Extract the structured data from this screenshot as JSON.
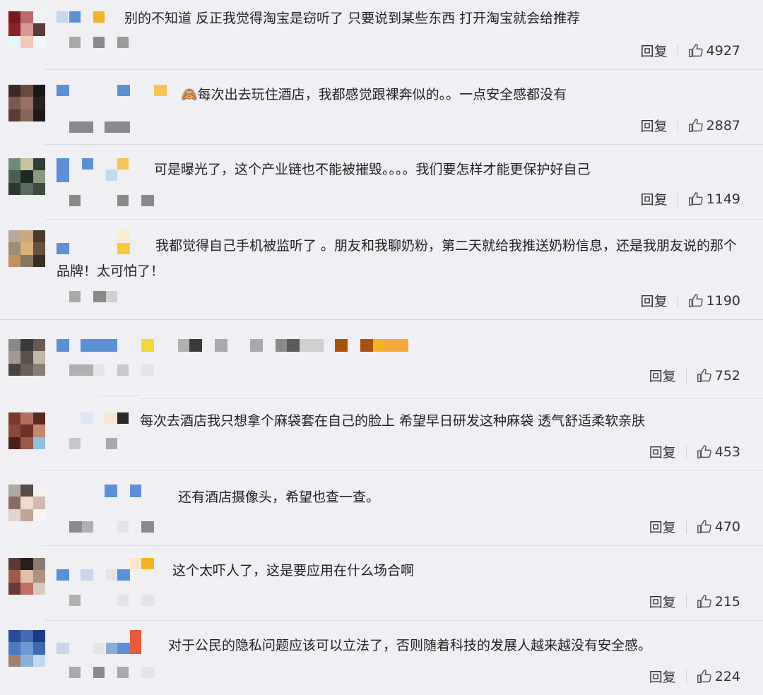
{
  "reply_label": "回复",
  "comments": [
    {
      "text": "别的不知道 反正我觉得淘宝是窃听了 只要说到某些东西 打开淘宝就会给推荐",
      "likes": "4927"
    },
    {
      "emoji": "🙈",
      "text": "每次出去玩住酒店，我都感觉跟裸奔似的。。一点安全感都没有",
      "likes": "2887"
    },
    {
      "text": "可是曝光了，这个产业链也不能被摧毁。。。。我们要怎样才能更保护好自己",
      "likes": "1149"
    },
    {
      "text": "我都觉得自己手机被监听了 。朋友和我聊奶粉，第二天就给我推送奶粉信息，还是我朋友说的那个品牌！太可怕了！",
      "likes": "1190"
    },
    {
      "text": "",
      "likes": "752"
    },
    {
      "text": "每次去酒店我只想拿个麻袋套在自己的脸上 希望早日研发这种麻袋 透气舒适柔软亲肤",
      "likes": "453"
    },
    {
      "text": "还有酒店摄像头，希望也查一查。",
      "likes": "470"
    },
    {
      "text": "这个太吓人了，这是要应用在什么场合啊",
      "likes": "215"
    },
    {
      "text": "对于公民的隐私问题应该可以立法了，否则随着科技的发展人越来越没有安全感。",
      "likes": "224"
    }
  ]
}
